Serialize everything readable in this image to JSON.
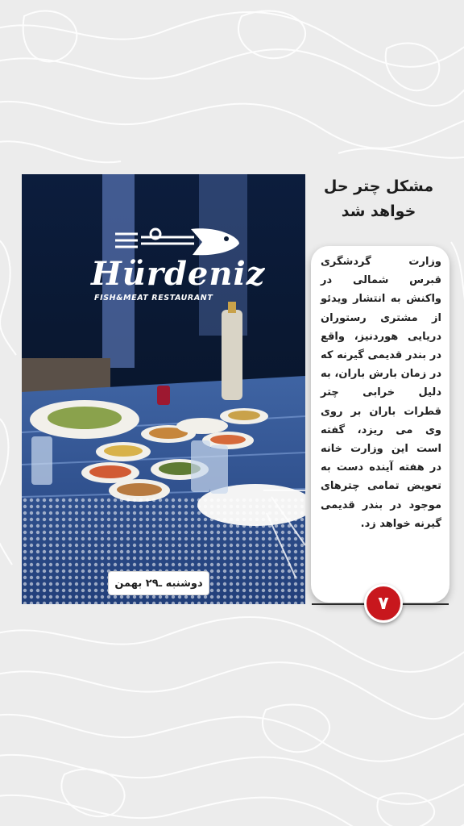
{
  "headline": "مشکل چتر حل خواهد شد",
  "body": "وزارت گردشگری قبرس شمالی در واکنش به انتشار ویدئو از مشتری رستوران دریایی هوردنیز، واقع در بندر قدیمی گیرنه که در زمان بارش باران، به دلیل خرابی چتر قطرات باران بر روی وی می ریزد، گفته است این وزارت خانه در هفته آینده دست به تعویض تمامی چترهای موجود در بندر قدیمی گیرنه خواهد زد.",
  "photo": {
    "logo_name": "Hürdeniz",
    "logo_sub": "FISH&MEAT RESTAURANT",
    "date_label": "دوشنبه ـ۲۹ بهمن"
  },
  "page_number": "۷",
  "colors": {
    "background": "#ececec",
    "accent_red": "#c8171d",
    "card": "#ffffff"
  },
  "icons": [
    "fish-logo-icon",
    "topographic-pattern"
  ]
}
